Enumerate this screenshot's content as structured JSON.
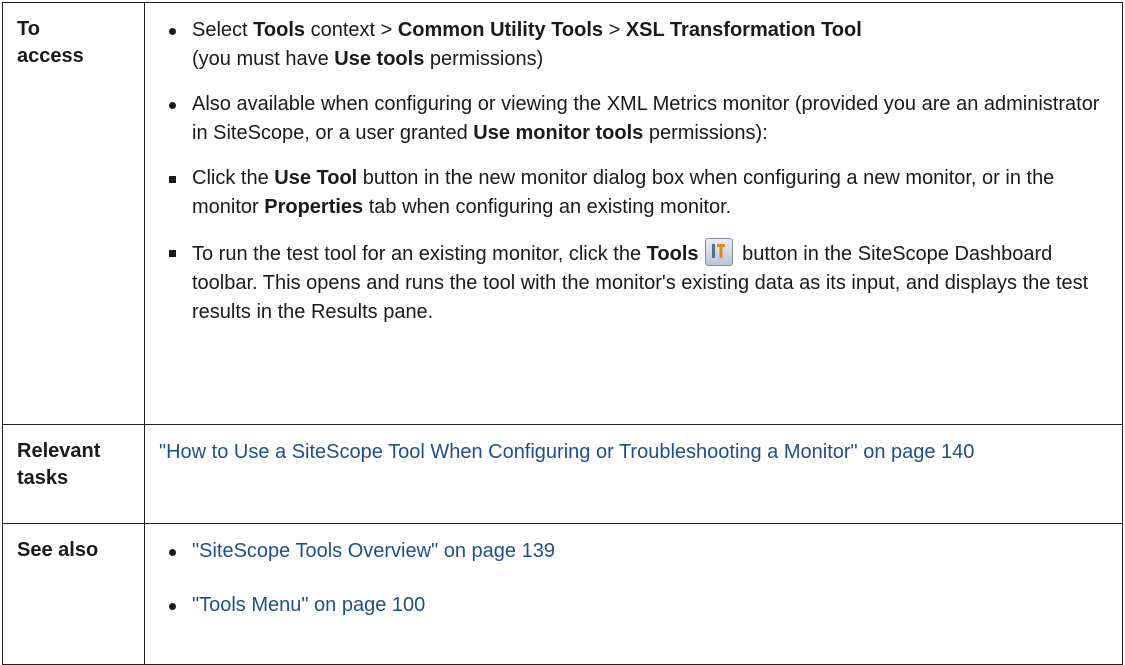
{
  "rows": [
    {
      "label_line1": "To",
      "label_line2": "access",
      "bullet1": {
        "t1": "Select ",
        "b1": "Tools",
        "t2": " context > ",
        "b2": "Common Utility Tools",
        "t3": " > ",
        "b3": "XSL Transformation Tool",
        "t4": "(you must have ",
        "b4": "Use tools",
        "t5": " permissions)"
      },
      "bullet2": {
        "t1": "Also available when configuring or viewing the XML Metrics monitor (provided you are an administrator in SiteScope, or a user granted ",
        "b1": "Use monitor tools",
        "t2": " permissions):"
      },
      "sub1": {
        "t1": "Click the ",
        "b1": "Use Tool",
        "t2": " button in the new monitor dialog box when configuring a new monitor, or in the monitor ",
        "b2": "Properties",
        "t3": " tab when configuring an existing monitor."
      },
      "sub2": {
        "t1": "To run the test tool for an existing monitor, click the ",
        "b1": "Tools",
        "t2": " button in the SiteScope Dashboard toolbar. This opens and runs the tool with the monitor's existing data as its input, and displays the test results in the Results pane."
      }
    },
    {
      "label_line1": "Relevant",
      "label_line2": "tasks",
      "link": "\"How to Use a SiteScope Tool When Configuring or Troubleshooting a Monitor\" on page 140"
    },
    {
      "label_line1": "See also",
      "links": [
        "\"SiteScope Tools Overview\" on page 139",
        "\"Tools Menu\" on page 100"
      ]
    }
  ],
  "icons": {
    "tools_button": "tools-icon"
  },
  "colors": {
    "link": "#1f4f8a",
    "border": "#222222"
  }
}
